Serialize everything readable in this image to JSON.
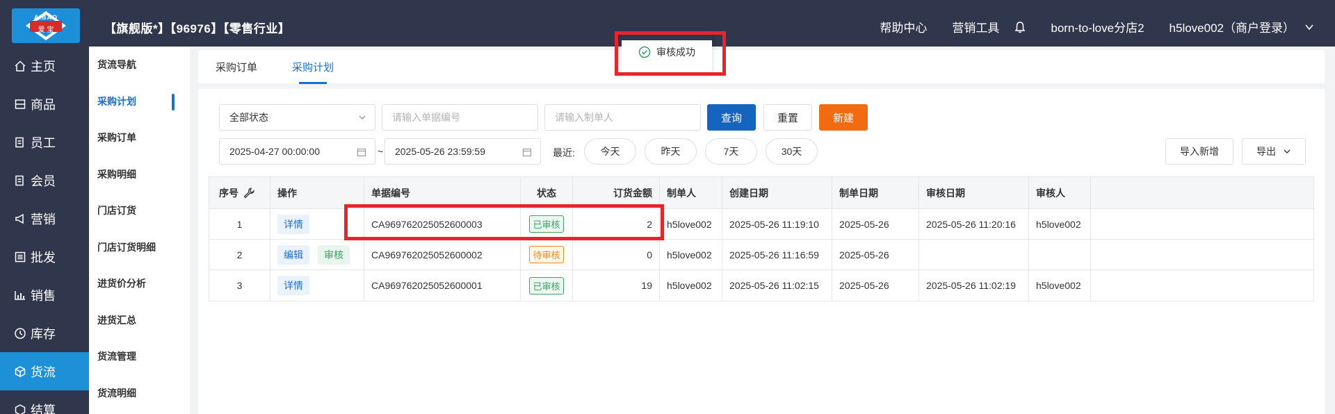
{
  "header": {
    "logo_brand": "AIBAO",
    "logo_sub": "爱 宝",
    "shop_title": "【旗舰版*】【96976】【零售行业】",
    "help": "帮助中心",
    "marketing": "营销工具",
    "store": "born-to-love分店2",
    "user": "h5love002（商户登录）"
  },
  "sidebar": [
    {
      "label": "主页",
      "icon": "home-icon"
    },
    {
      "label": "商品",
      "icon": "goods-icon"
    },
    {
      "label": "员工",
      "icon": "staff-icon"
    },
    {
      "label": "会员",
      "icon": "member-icon"
    },
    {
      "label": "营销",
      "icon": "megaphone-icon"
    },
    {
      "label": "批发",
      "icon": "wholesale-icon"
    },
    {
      "label": "销售",
      "icon": "chart-icon"
    },
    {
      "label": "库存",
      "icon": "clock-icon"
    },
    {
      "label": "货流",
      "icon": "cube-icon",
      "active": true
    },
    {
      "label": "结算",
      "icon": "settle-icon"
    }
  ],
  "subnav": [
    "货流导航",
    "采购计划",
    "采购订单",
    "采购明细",
    "门店订货",
    "门店订货明细",
    "进货价分析",
    "进货汇总",
    "货流管理",
    "货流明细"
  ],
  "tabs": [
    "采购订单",
    "采购计划"
  ],
  "filters": {
    "status": "全部状态",
    "doc_no_placeholder": "请输入单据编号",
    "maker_placeholder": "请输入制单人",
    "query": "查询",
    "reset": "重置",
    "new": "新建",
    "date_from": "2025-04-27 00:00:00",
    "tilde": "~",
    "date_to": "2025-05-26 23:59:59",
    "recent_label": "最近:",
    "today": "今天",
    "yesterday": "昨天",
    "d7": "7天",
    "d30": "30天",
    "import": "导入新增",
    "export": "导出"
  },
  "table": {
    "headers": [
      "序号",
      "操作",
      "单据编号",
      "状态",
      "订货金额",
      "制单人",
      "创建日期",
      "制单日期",
      "审核日期",
      "审核人"
    ],
    "rows": [
      {
        "idx": "1",
        "ops": [
          "详情"
        ],
        "no": "CA969762025052600003",
        "status": "已审核",
        "status_type": "ok",
        "amount": "2",
        "maker": "h5love002",
        "created": "2025-05-26 11:19:10",
        "made": "2025-05-26",
        "audited": "2025-05-26 11:20:16",
        "auditor": "h5love002"
      },
      {
        "idx": "2",
        "ops": [
          "编辑",
          "审核"
        ],
        "no": "CA969762025052600002",
        "status": "待审核",
        "status_type": "pending",
        "amount": "0",
        "maker": "h5love002",
        "created": "2025-05-26 11:16:59",
        "made": "2025-05-26",
        "audited": "",
        "auditor": ""
      },
      {
        "idx": "3",
        "ops": [
          "详情"
        ],
        "no": "CA969762025052600001",
        "status": "已审核",
        "status_type": "ok",
        "amount": "19",
        "maker": "h5love002",
        "created": "2025-05-26 11:02:15",
        "made": "2025-05-26",
        "audited": "2025-05-26 11:02:19",
        "auditor": "h5love002"
      }
    ]
  },
  "toast": {
    "text": "审核成功"
  },
  "colors": {
    "topbar": "#30364c",
    "accent": "#1a6fd1",
    "active_side": "#1e90d8",
    "new_button": "#f26b10",
    "highlight": "#e8242c"
  }
}
